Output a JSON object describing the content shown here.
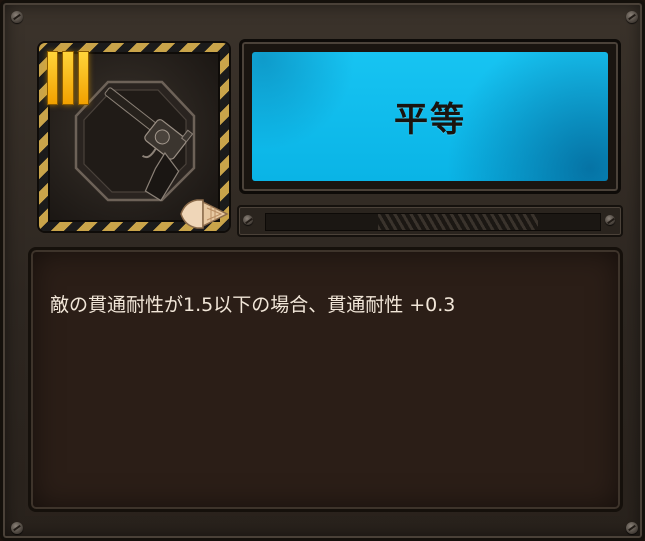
{
  "card": {
    "rank_label": "III",
    "title": "平等",
    "description": "敵の貫通耐性が1.5以下の場合、貫通耐性 +0.3",
    "icon": "revolver-icon",
    "badge_icon": "bullet-icon",
    "colors": {
      "title_bg": "#12bceb",
      "rank": "#f7b500",
      "hazard_stripe": "#c9a44a",
      "panel": "#2e2721",
      "desc_bg": "#2b1e17",
      "text": "#f1e6d8"
    }
  }
}
